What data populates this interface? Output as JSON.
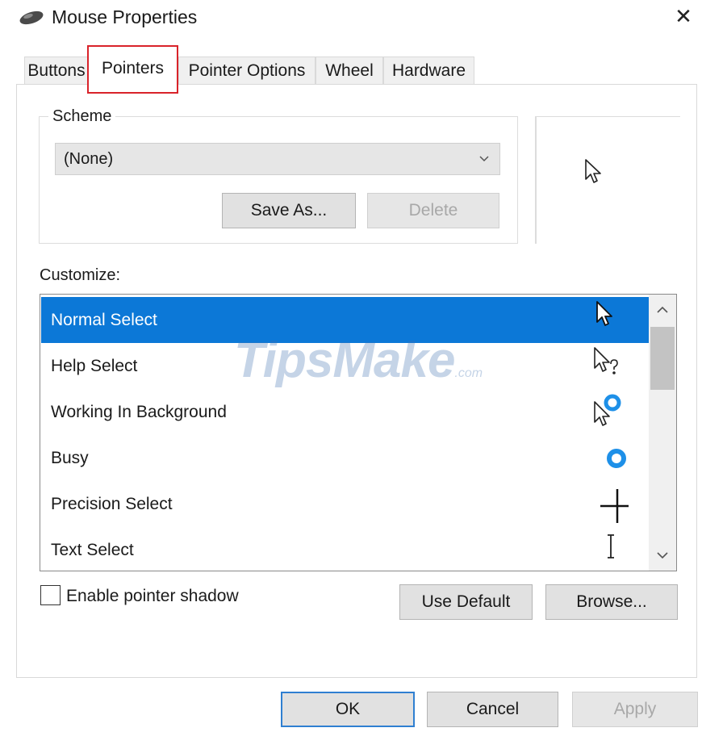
{
  "window": {
    "title": "Mouse Properties",
    "close_glyph": "✕",
    "icon": "mouse-icon"
  },
  "tabs": [
    {
      "label": "Buttons",
      "active": false
    },
    {
      "label": "Pointers",
      "active": true
    },
    {
      "label": "Pointer Options",
      "active": false
    },
    {
      "label": "Wheel",
      "active": false
    },
    {
      "label": "Hardware",
      "active": false
    }
  ],
  "scheme": {
    "group_label": "Scheme",
    "selected_value": "(None)",
    "save_as_label": "Save As...",
    "delete_label": "Delete",
    "delete_enabled": false
  },
  "preview": {
    "icon": "arrow-pointer-icon"
  },
  "customize": {
    "label": "Customize:",
    "items": [
      {
        "label": "Normal Select",
        "icon": "arrow-pointer-icon",
        "selected": true
      },
      {
        "label": "Help Select",
        "icon": "help-pointer-icon",
        "selected": false
      },
      {
        "label": "Working In Background",
        "icon": "working-pointer-icon",
        "selected": false
      },
      {
        "label": "Busy",
        "icon": "busy-ring-icon",
        "selected": false
      },
      {
        "label": "Precision Select",
        "icon": "crosshair-icon",
        "selected": false
      },
      {
        "label": "Text Select",
        "icon": "text-ibeam-icon",
        "selected": false
      }
    ],
    "scroll_up_glyph": "^",
    "scroll_down_glyph": "v"
  },
  "watermark": {
    "brand": "TipsMake",
    "suffix": ".com"
  },
  "shadow": {
    "label": "Enable pointer shadow",
    "checked": false
  },
  "actions": {
    "use_default_label": "Use Default",
    "browse_label": "Browse..."
  },
  "dialog_buttons": {
    "ok_label": "OK",
    "cancel_label": "Cancel",
    "apply_label": "Apply",
    "apply_enabled": false
  },
  "colors": {
    "selection": "#0c78d7",
    "tab_highlight": "#d9232a",
    "busy_ring": "#1e90e8"
  }
}
